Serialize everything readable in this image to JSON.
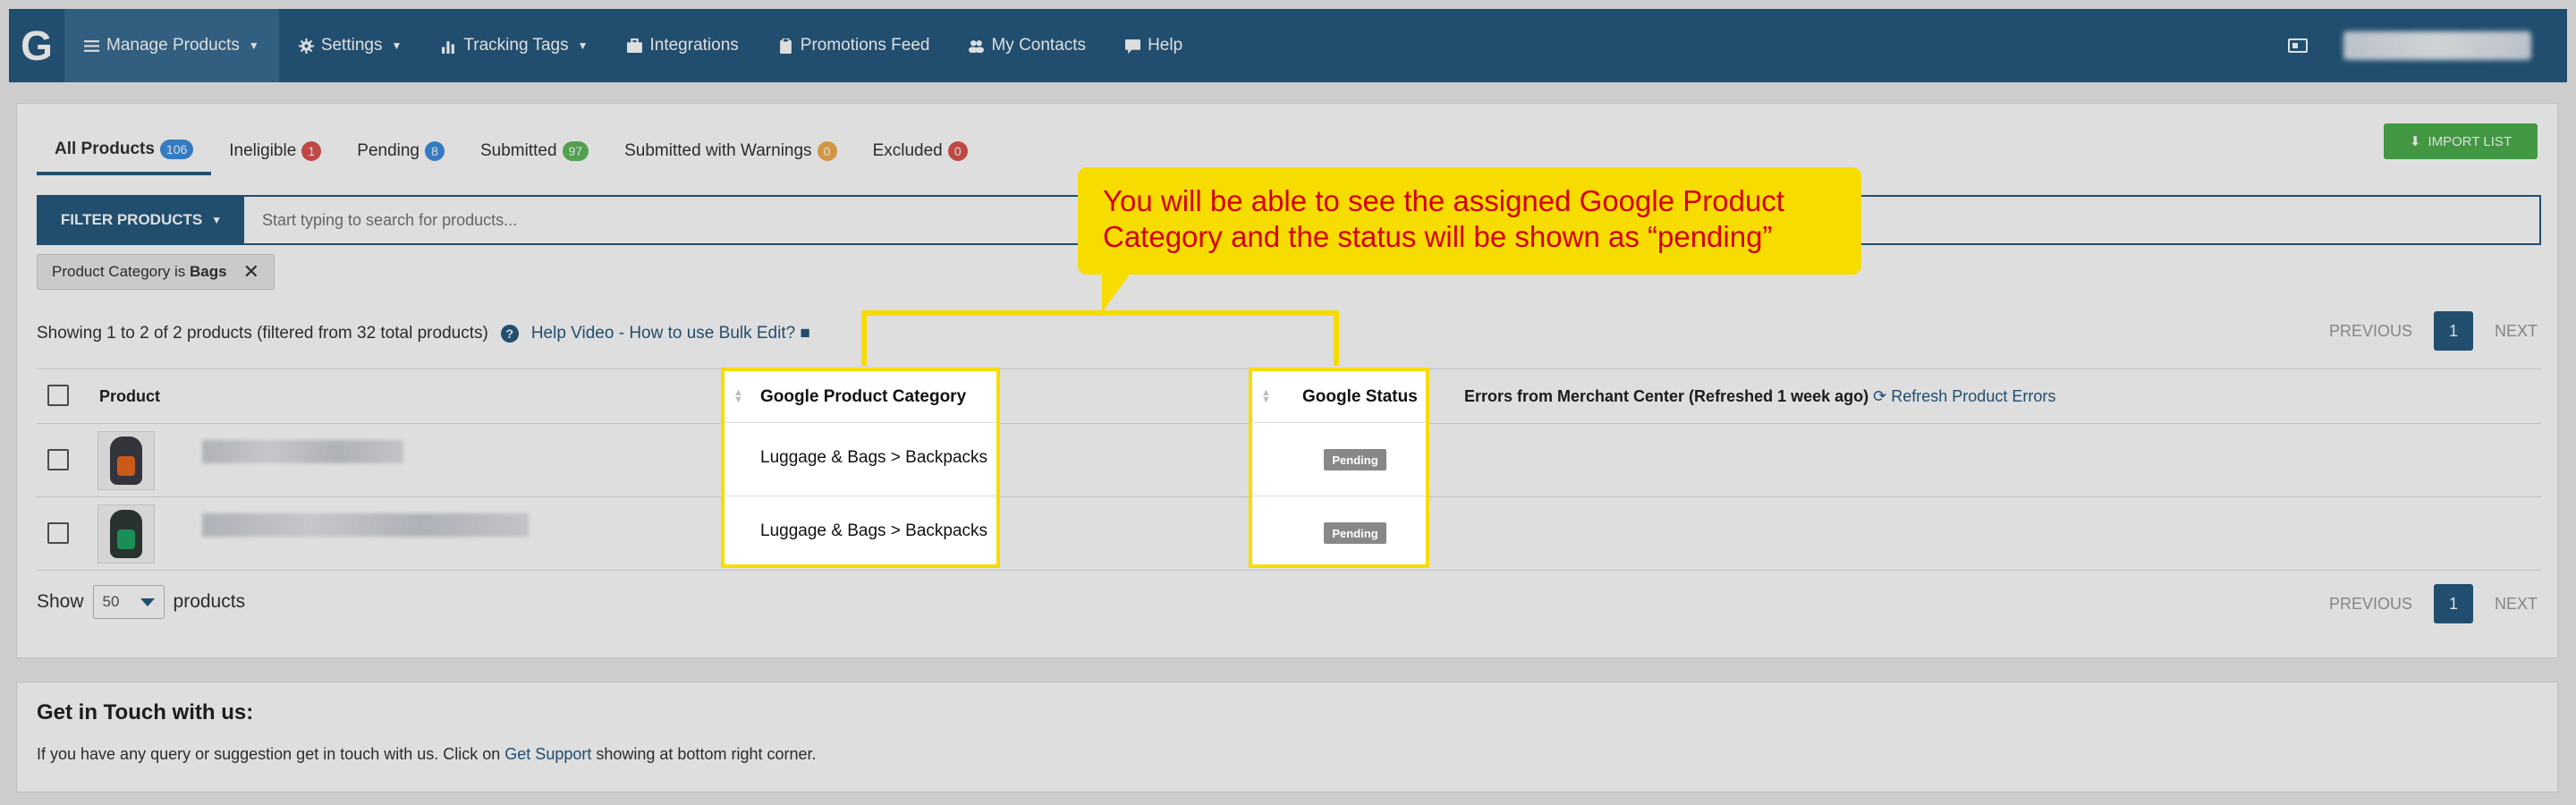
{
  "nav": {
    "logo": "G",
    "items": [
      {
        "label": "Manage Products",
        "caret": true
      },
      {
        "label": "Settings",
        "caret": true
      },
      {
        "label": "Tracking Tags",
        "caret": true
      },
      {
        "label": "Integrations",
        "caret": false
      },
      {
        "label": "Promotions Feed",
        "caret": false
      },
      {
        "label": "My Contacts",
        "caret": false
      },
      {
        "label": "Help",
        "caret": false
      }
    ]
  },
  "tabs": [
    {
      "label": "All Products",
      "count": "106",
      "color": "#3d8ede"
    },
    {
      "label": "Ineligible",
      "count": "1",
      "color": "#d9534f"
    },
    {
      "label": "Pending",
      "count": "8",
      "color": "#3d8ede"
    },
    {
      "label": "Submitted",
      "count": "97",
      "color": "#5cb85c"
    },
    {
      "label": "Submitted with Warnings",
      "count": "0",
      "color": "#f0ad4e"
    },
    {
      "label": "Excluded",
      "count": "0",
      "color": "#d9534f"
    }
  ],
  "import_label": "IMPORT LIST",
  "filter": {
    "button_label": "FILTER PRODUCTS",
    "placeholder": "Start typing to search for products...",
    "chip_prefix": "Product Category is ",
    "chip_value": "Bags"
  },
  "showing_text": "Showing 1 to 2 of 2 products (filtered from 32 total products)",
  "help_video": "Help Video - How to use Bulk Edit?",
  "pager": {
    "previous": "PREVIOUS",
    "page": "1",
    "next": "NEXT"
  },
  "table": {
    "col_product": "Product",
    "col_category": "Google Product Category",
    "col_status": "Google Status",
    "col_errors": "Errors from Merchant Center (Refreshed 1 week ago)",
    "refresh_label": "Refresh Product Errors",
    "rows": [
      {
        "category": "Luggage & Bags > Backpacks",
        "status": "Pending"
      },
      {
        "category": "Luggage & Bags > Backpacks",
        "status": "Pending"
      }
    ]
  },
  "show": {
    "prefix": "Show",
    "value": "50",
    "suffix": "products"
  },
  "footer": {
    "title": "Get in Touch with us:",
    "text_before": "If you have any query or suggestion get in touch with us. Click on ",
    "link": "Get Support",
    "text_after": " showing at bottom right corner."
  },
  "callout": "You will be able to see the assigned Google Product Category and the status will be shown as “pending”"
}
